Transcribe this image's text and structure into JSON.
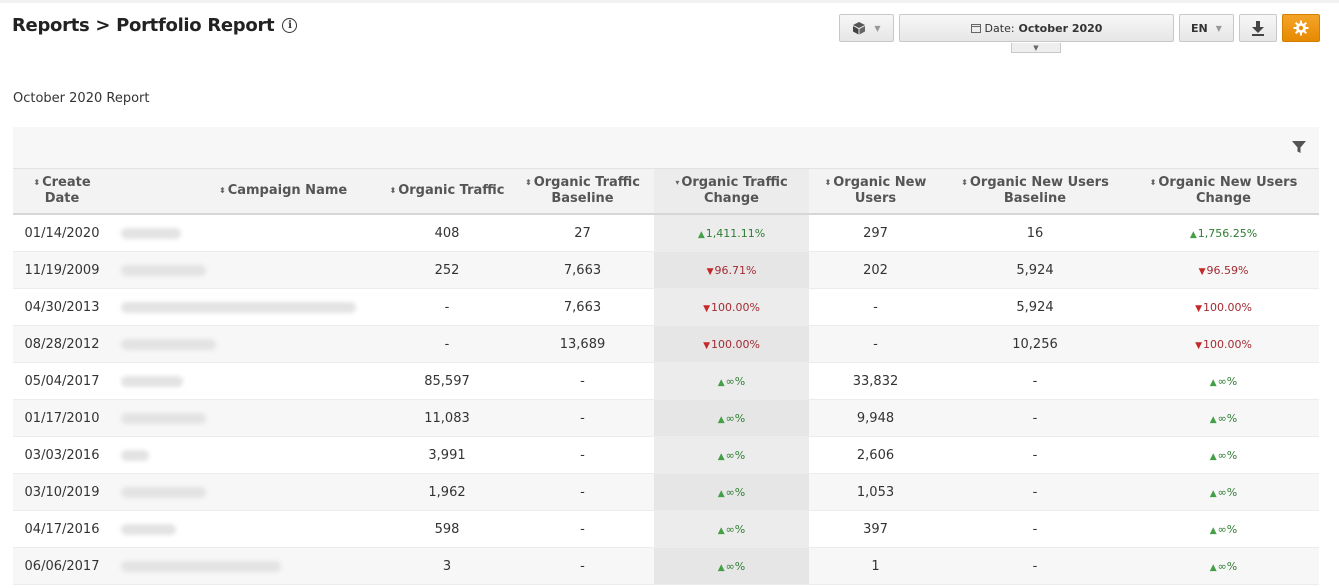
{
  "header": {
    "title": "Reports > Portfolio Report",
    "info_icon": "ⓘ"
  },
  "toolbar": {
    "date_prefix": "Date:",
    "date_value": "October 2020",
    "lang": "EN",
    "accent": "#f39c12"
  },
  "report": {
    "subtitle": "October 2020 Report",
    "columns": [
      "Create Date",
      "Campaign Name",
      "Organic Traffic",
      "Organic Traffic Baseline",
      "Organic Traffic Change",
      "Organic New Users",
      "Organic New Users Baseline",
      "Organic New Users Change"
    ],
    "rows": [
      {
        "date": "01/14/2020",
        "traffic": "408",
        "traffic_base": "27",
        "traffic_change": "1,411.11%",
        "traffic_dir": "up",
        "users": "297",
        "users_base": "16",
        "users_change": "1,756.25%",
        "users_dir": "up"
      },
      {
        "date": "11/19/2009",
        "traffic": "252",
        "traffic_base": "7,663",
        "traffic_change": "96.71%",
        "traffic_dir": "down",
        "users": "202",
        "users_base": "5,924",
        "users_change": "96.59%",
        "users_dir": "down"
      },
      {
        "date": "04/30/2013",
        "traffic": "-",
        "traffic_base": "7,663",
        "traffic_change": "100.00%",
        "traffic_dir": "down",
        "users": "-",
        "users_base": "5,924",
        "users_change": "100.00%",
        "users_dir": "down"
      },
      {
        "date": "08/28/2012",
        "traffic": "-",
        "traffic_base": "13,689",
        "traffic_change": "100.00%",
        "traffic_dir": "down",
        "users": "-",
        "users_base": "10,256",
        "users_change": "100.00%",
        "users_dir": "down"
      },
      {
        "date": "05/04/2017",
        "traffic": "85,597",
        "traffic_base": "-",
        "traffic_change": "∞%",
        "traffic_dir": "up",
        "users": "33,832",
        "users_base": "-",
        "users_change": "∞%",
        "users_dir": "up"
      },
      {
        "date": "01/17/2010",
        "traffic": "11,083",
        "traffic_base": "-",
        "traffic_change": "∞%",
        "traffic_dir": "up",
        "users": "9,948",
        "users_base": "-",
        "users_change": "∞%",
        "users_dir": "up"
      },
      {
        "date": "03/03/2016",
        "traffic": "3,991",
        "traffic_base": "-",
        "traffic_change": "∞%",
        "traffic_dir": "up",
        "users": "2,606",
        "users_base": "-",
        "users_change": "∞%",
        "users_dir": "up"
      },
      {
        "date": "03/10/2019",
        "traffic": "1,962",
        "traffic_base": "-",
        "traffic_change": "∞%",
        "traffic_dir": "up",
        "users": "1,053",
        "users_base": "-",
        "users_change": "∞%",
        "users_dir": "up"
      },
      {
        "date": "04/17/2016",
        "traffic": "598",
        "traffic_base": "-",
        "traffic_change": "∞%",
        "traffic_dir": "up",
        "users": "397",
        "users_base": "-",
        "users_change": "∞%",
        "users_dir": "up"
      },
      {
        "date": "06/06/2017",
        "traffic": "3",
        "traffic_base": "-",
        "traffic_change": "∞%",
        "traffic_dir": "up",
        "users": "1",
        "users_base": "-",
        "users_change": "∞%",
        "users_dir": "up"
      }
    ]
  }
}
